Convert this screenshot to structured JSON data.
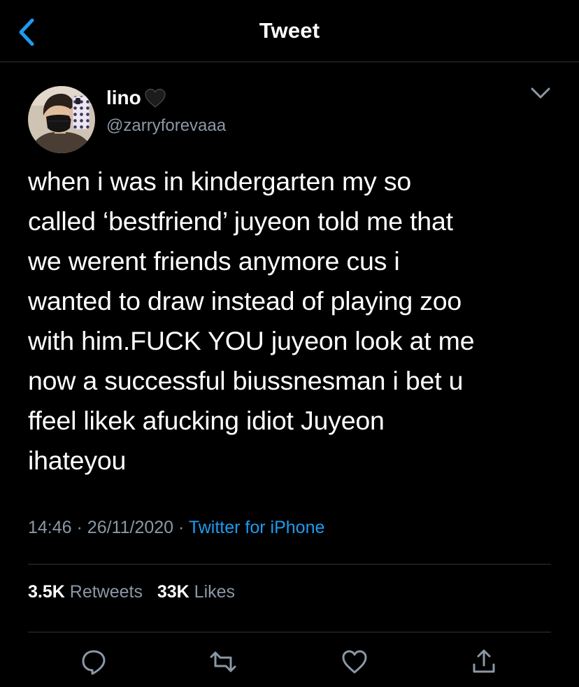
{
  "header": {
    "title": "Tweet",
    "back_icon": "chevron-left-icon",
    "accent_color": "#1d9bf0"
  },
  "tweet": {
    "author": {
      "display_name": "lino",
      "emoji_icon": "black-heart-icon",
      "handle": "@zarryforevaaa"
    },
    "text": "when i was in kindergarten my so\ncalled ‘bestfriend’ juyeon told me that\nwe werent friends anymore cus i\nwanted to draw instead of playing zoo\nwith him.FUCK YOU juyeon look at me\nnow a successful biussnesman i bet u\nffeel likek afucking idiot Juyeon\nihateyou",
    "time": "14:46",
    "separator": "·",
    "date": "26/11/2020",
    "source": "Twitter for iPhone",
    "stats": {
      "retweets_count": "3.5K",
      "retweets_label": "Retweets",
      "likes_count": "33K",
      "likes_label": "Likes"
    }
  },
  "actions": [
    {
      "name": "reply",
      "icon": "reply-icon"
    },
    {
      "name": "retweet",
      "icon": "retweet-icon"
    },
    {
      "name": "like",
      "icon": "heart-icon"
    },
    {
      "name": "share",
      "icon": "share-icon"
    }
  ],
  "colors": {
    "background": "#000000",
    "text": "#ffffff",
    "secondary_text": "#8b98a5",
    "divider": "#2f3336"
  }
}
